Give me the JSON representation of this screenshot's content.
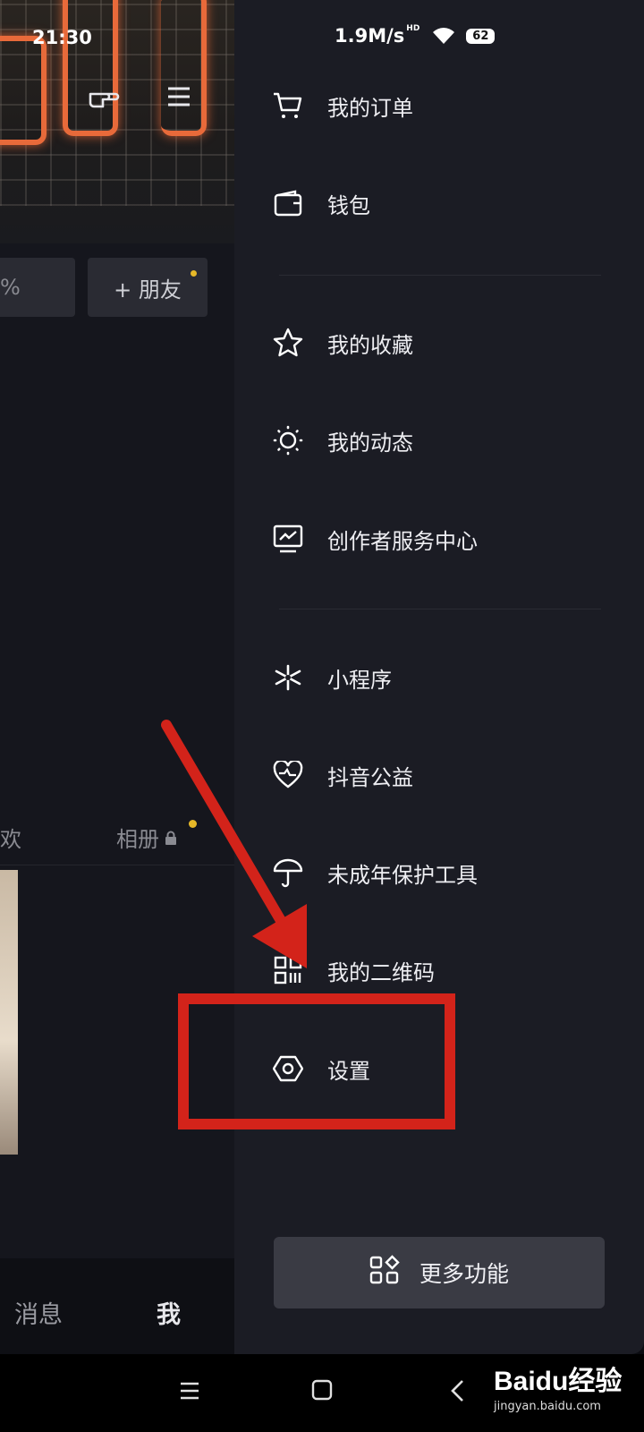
{
  "status_bar": {
    "time": "21:30",
    "speed": "1.9M/s",
    "hd": "HD",
    "battery": "62"
  },
  "background": {
    "friend_button": "+ 朋友",
    "left_button_fragment": "%",
    "tab_fragment": "欢",
    "album_tab": "相册",
    "nav_messages": "消息",
    "nav_me": "我"
  },
  "drawer": {
    "items": [
      {
        "label": "我的订单",
        "icon": "cart-icon"
      },
      {
        "label": "钱包",
        "icon": "wallet-icon"
      },
      {
        "label": "我的收藏",
        "icon": "star-icon"
      },
      {
        "label": "我的动态",
        "icon": "sun-icon"
      },
      {
        "label": "创作者服务中心",
        "icon": "chart-monitor-icon"
      },
      {
        "label": "小程序",
        "icon": "mini-program-icon"
      },
      {
        "label": "抖音公益",
        "icon": "heart-icon"
      },
      {
        "label": "未成年保护工具",
        "icon": "umbrella-icon"
      },
      {
        "label": "我的二维码",
        "icon": "qrcode-icon"
      },
      {
        "label": "设置",
        "icon": "settings-hex-icon"
      }
    ],
    "more_button": "更多功能"
  },
  "watermark": {
    "brand": "Baidu经验",
    "url": "jingyan.baidu.com"
  },
  "colors": {
    "drawer_bg": "#1b1c24",
    "annotation_red": "#d3231a",
    "accent_dot": "#e6b828"
  }
}
